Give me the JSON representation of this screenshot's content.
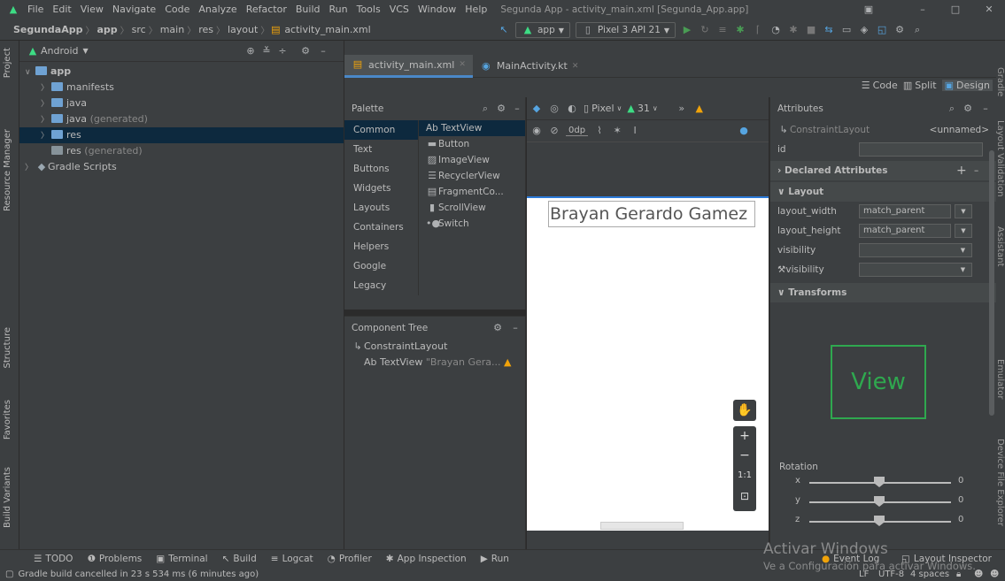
{
  "window": {
    "title": "Segunda App - activity_main.xml [Segunda_App.app]",
    "menu": [
      "File",
      "Edit",
      "View",
      "Navigate",
      "Code",
      "Analyze",
      "Refactor",
      "Build",
      "Run",
      "Tools",
      "VCS",
      "Window",
      "Help"
    ]
  },
  "breadcrumb": [
    "SegundaApp",
    "app",
    "src",
    "main",
    "res",
    "layout",
    "activity_main.xml"
  ],
  "toolbar": {
    "module": "app",
    "device": "Pixel 3 API 21"
  },
  "sidebar_left": {
    "tabs": [
      "Project",
      "Resource Manager",
      "Structure",
      "Favorites",
      "Build Variants"
    ]
  },
  "sidebar_right": {
    "tabs": [
      "Gradle",
      "Layout Validation",
      "Assistant",
      "Emulator",
      "Device File Explorer"
    ]
  },
  "project": {
    "view": "Android",
    "tree": [
      {
        "label": "app",
        "suffix": "",
        "level": 0,
        "expanded": true
      },
      {
        "label": "manifests",
        "suffix": "",
        "level": 1
      },
      {
        "label": "java",
        "suffix": "",
        "level": 1
      },
      {
        "label": "java",
        "suffix": "(generated)",
        "level": 1
      },
      {
        "label": "res",
        "suffix": "",
        "level": 1,
        "selected": true
      },
      {
        "label": "res",
        "suffix": "(generated)",
        "level": 1
      },
      {
        "label": "Gradle Scripts",
        "suffix": "",
        "level": 0
      }
    ]
  },
  "editor": {
    "tabs": [
      {
        "label": "activity_main.xml",
        "active": true
      },
      {
        "label": "MainActivity.kt",
        "active": false
      }
    ],
    "modes": [
      "Code",
      "Split",
      "Design"
    ],
    "active_mode": "Design"
  },
  "palette": {
    "title": "Palette",
    "categories": [
      "Common",
      "Text",
      "Buttons",
      "Widgets",
      "Layouts",
      "Containers",
      "Helpers",
      "Google",
      "Legacy"
    ],
    "items": [
      "Ab TextView",
      "Button",
      "ImageView",
      "RecyclerView",
      "FragmentCo...",
      "ScrollView",
      "Switch"
    ]
  },
  "component_tree": {
    "title": "Component Tree",
    "root": "ConstraintLayout",
    "child": "TextView",
    "child_prefix": "Ab",
    "child_text": "\"Brayan Gera..."
  },
  "design_toolbar": {
    "device": "Pixel",
    "api": "31",
    "margin": "0dp"
  },
  "canvas": {
    "textview_text": "Brayan Gerardo Gamez",
    "zoom_label": "1:1"
  },
  "attributes": {
    "title": "Attributes",
    "component": "ConstraintLayout",
    "component_id": "<unnamed>",
    "id_label": "id",
    "declared": "Declared Attributes",
    "layout_section": "Layout",
    "rows": [
      {
        "label": "layout_width",
        "value": "match_parent"
      },
      {
        "label": "layout_height",
        "value": "match_parent"
      },
      {
        "label": "visibility",
        "value": ""
      },
      {
        "label": "visibility",
        "value": ""
      }
    ],
    "transforms": "Transforms",
    "view_preview": "View",
    "rotation_label": "Rotation",
    "rotation": [
      {
        "axis": "x",
        "value": "0"
      },
      {
        "axis": "y",
        "value": "0"
      },
      {
        "axis": "z",
        "value": "0"
      }
    ]
  },
  "bottom_tools": [
    "TODO",
    "Problems",
    "Terminal",
    "Build",
    "Logcat",
    "Profiler",
    "App Inspection",
    "Run"
  ],
  "bottom_right": [
    "Event Log",
    "Layout Inspector"
  ],
  "status_message": "Gradle build cancelled in 23 s 534 ms (6 minutes ago)",
  "status_right": [
    "LF",
    "UTF-8",
    "4 spaces"
  ],
  "watermark": {
    "line1": "Activar Windows",
    "line2": "Ve a Configuración para activar Windows."
  },
  "colors": {
    "accent": "#4a88c7",
    "warning": "#f0a30a",
    "view_preview": "#2fa84f"
  }
}
